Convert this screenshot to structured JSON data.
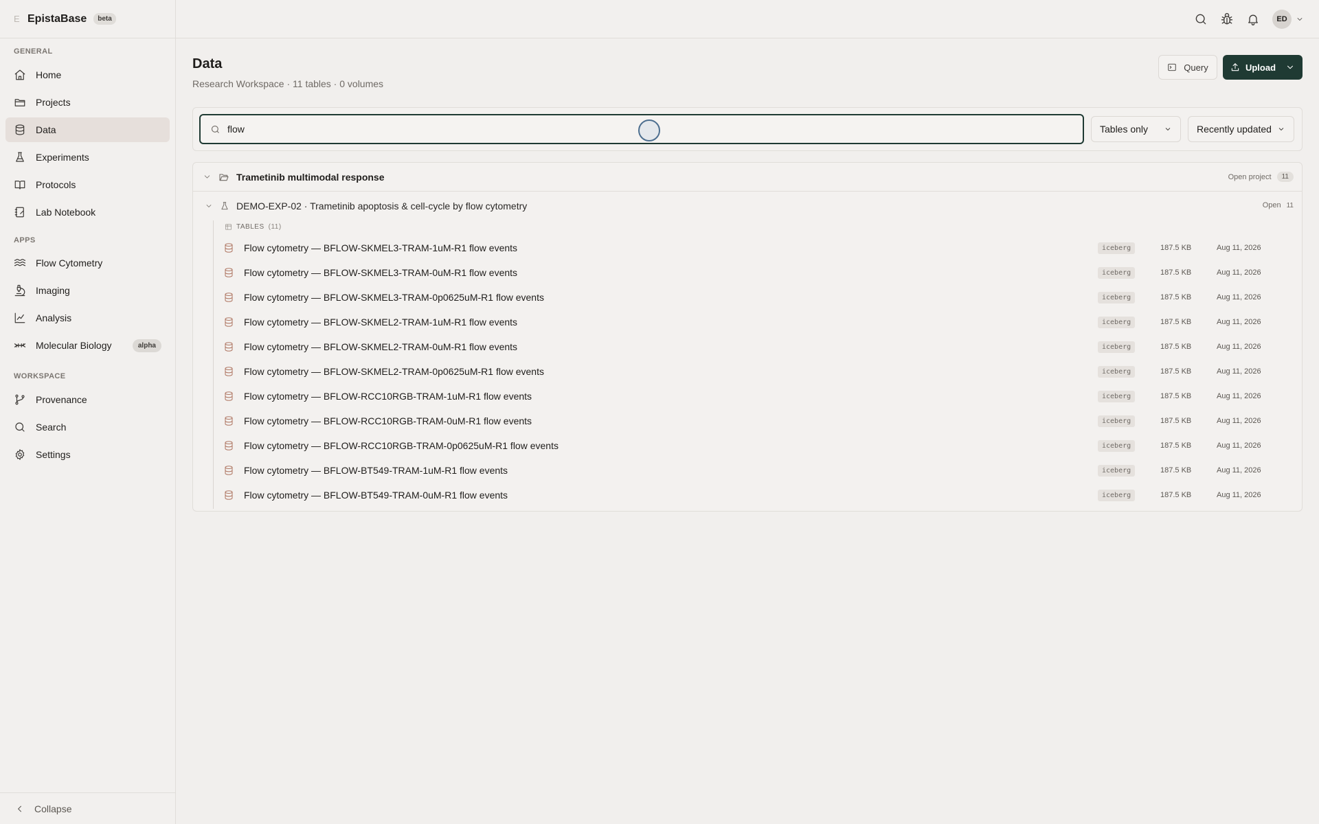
{
  "brand": {
    "mark": "E",
    "name": "EpistaBase",
    "badge": "beta"
  },
  "sidebar": {
    "sections": {
      "general": "GENERAL",
      "apps": "APPS",
      "workspace": "WORKSPACE"
    },
    "items": [
      {
        "label": "Home",
        "icon": "home-icon"
      },
      {
        "label": "Projects",
        "icon": "folder-icon"
      },
      {
        "label": "Data",
        "icon": "database-icon",
        "active": true
      },
      {
        "label": "Experiments",
        "icon": "flask-icon"
      },
      {
        "label": "Protocols",
        "icon": "book-icon"
      },
      {
        "label": "Lab Notebook",
        "icon": "notebook-icon"
      },
      {
        "label": "Flow Cytometry",
        "icon": "waves-icon"
      },
      {
        "label": "Imaging",
        "icon": "microscope-icon"
      },
      {
        "label": "Analysis",
        "icon": "line-chart-icon"
      },
      {
        "label": "Molecular Biology",
        "icon": "dna-icon",
        "badge": "alpha"
      },
      {
        "label": "Provenance",
        "icon": "git-branch-icon"
      },
      {
        "label": "Search",
        "icon": "search-icon"
      },
      {
        "label": "Settings",
        "icon": "gear-icon"
      }
    ],
    "collapse_label": "Collapse"
  },
  "header": {
    "avatar_initials": "ED"
  },
  "main": {
    "title": "Data",
    "subtitle": "Research Workspace · 11 tables · 0 volumes",
    "query_label": "Query",
    "upload_label": "Upload",
    "search": {
      "value": "flow",
      "placeholder": ""
    },
    "filter_select": "Tables only",
    "sort_select": "Recently updated"
  },
  "results": {
    "project": {
      "name": "Trametinib multimodal response",
      "action": "Open project",
      "count": "11"
    },
    "experiment": {
      "name": "DEMO-EXP-02 · Trametinib apoptosis & cell-cycle by flow cytometry",
      "action": "Open",
      "count": "11"
    },
    "tables_heading": "TABLES",
    "tables_count": "(11)",
    "tables": [
      {
        "name": "Flow cytometry — BFLOW-SKMEL3-TRAM-1uM-R1 flow events",
        "format": "iceberg",
        "size": "187.5 KB",
        "date": "Aug 11, 2026"
      },
      {
        "name": "Flow cytometry — BFLOW-SKMEL3-TRAM-0uM-R1 flow events",
        "format": "iceberg",
        "size": "187.5 KB",
        "date": "Aug 11, 2026"
      },
      {
        "name": "Flow cytometry — BFLOW-SKMEL3-TRAM-0p0625uM-R1 flow events",
        "format": "iceberg",
        "size": "187.5 KB",
        "date": "Aug 11, 2026"
      },
      {
        "name": "Flow cytometry — BFLOW-SKMEL2-TRAM-1uM-R1 flow events",
        "format": "iceberg",
        "size": "187.5 KB",
        "date": "Aug 11, 2026"
      },
      {
        "name": "Flow cytometry — BFLOW-SKMEL2-TRAM-0uM-R1 flow events",
        "format": "iceberg",
        "size": "187.5 KB",
        "date": "Aug 11, 2026"
      },
      {
        "name": "Flow cytometry — BFLOW-SKMEL2-TRAM-0p0625uM-R1 flow events",
        "format": "iceberg",
        "size": "187.5 KB",
        "date": "Aug 11, 2026"
      },
      {
        "name": "Flow cytometry — BFLOW-RCC10RGB-TRAM-1uM-R1 flow events",
        "format": "iceberg",
        "size": "187.5 KB",
        "date": "Aug 11, 2026"
      },
      {
        "name": "Flow cytometry — BFLOW-RCC10RGB-TRAM-0uM-R1 flow events",
        "format": "iceberg",
        "size": "187.5 KB",
        "date": "Aug 11, 2026"
      },
      {
        "name": "Flow cytometry — BFLOW-RCC10RGB-TRAM-0p0625uM-R1 flow events",
        "format": "iceberg",
        "size": "187.5 KB",
        "date": "Aug 11, 2026"
      },
      {
        "name": "Flow cytometry — BFLOW-BT549-TRAM-1uM-R1 flow events",
        "format": "iceberg",
        "size": "187.5 KB",
        "date": "Aug 11, 2026"
      },
      {
        "name": "Flow cytometry — BFLOW-BT549-TRAM-0uM-R1 flow events",
        "format": "iceberg",
        "size": "187.5 KB",
        "date": "Aug 11, 2026"
      }
    ]
  },
  "colors": {
    "accent": "#1f3a33",
    "background": "#f1efed",
    "active_nav": "#e6dfdb"
  }
}
